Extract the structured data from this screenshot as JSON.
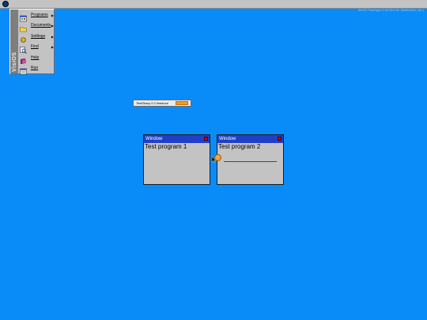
{
  "topbar": {
    "version_text": "VisOS Prototype 0.69 (Not for distribution, etc.)"
  },
  "start_menu": {
    "brand": "VisiOS",
    "items": [
      {
        "label": "Programs",
        "icon": "programs-icon",
        "submenu": true
      },
      {
        "label": "Documents",
        "icon": "documents-icon",
        "submenu": true
      },
      {
        "label": "Settings",
        "icon": "settings-icon",
        "submenu": true
      },
      {
        "label": "Find",
        "icon": "find-icon",
        "submenu": true
      },
      {
        "label": "Help",
        "icon": "help-icon",
        "submenu": false
      },
      {
        "label": "Run",
        "icon": "run-icon",
        "submenu": false
      }
    ],
    "submenu_arrow": "▶"
  },
  "task_app": {
    "label": "TestSharp 2.0 Instance"
  },
  "windows": [
    {
      "title": "Window",
      "content": "Test program 1"
    },
    {
      "title": "Window",
      "content": "Test program 2"
    }
  ],
  "colors": {
    "desktop": "#0a8cf8",
    "titlebar": "#1f3fc9",
    "close": "#d00000",
    "progress": "#f39b20"
  }
}
